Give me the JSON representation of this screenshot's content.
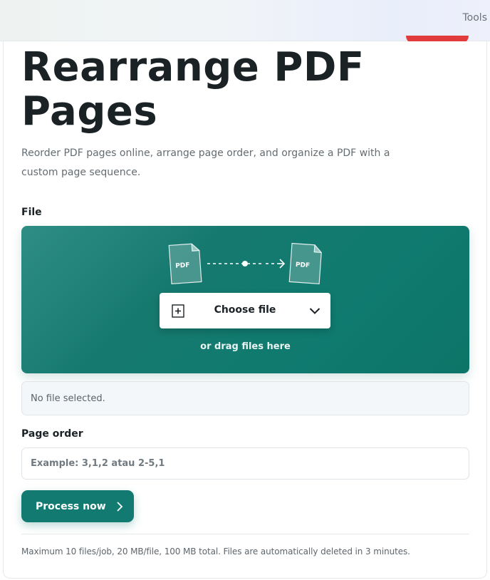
{
  "header": {
    "tools_label": "Tools"
  },
  "page": {
    "title": "Rearrange PDF Pages",
    "subtitle": "Reorder PDF pages online, arrange page order, and organize a PDF with a custom page sequence."
  },
  "upload": {
    "section_label": "File",
    "illustration": {
      "source_doc_label": "PDF",
      "target_doc_label": "PDF",
      "icons": [
        "pdf-document-icon",
        "dashed-arrow-icon",
        "pdf-document-icon"
      ]
    },
    "choose_button_label": "Choose file",
    "drag_hint": "or drag files here",
    "status_text": "No file selected."
  },
  "order": {
    "section_label": "Page order",
    "placeholder": "Example: 3,1,2 atau 2-5,1",
    "value": ""
  },
  "actions": {
    "process_label": "Process now"
  },
  "footer": {
    "note": "Maximum 10 files/job, 20 MB/file, 100 MB total. Files are automatically deleted in 3 minutes."
  },
  "colors": {
    "accent": "#127a70",
    "dropzone": "#0f7a6f",
    "brand_red": "#e23b3b"
  }
}
